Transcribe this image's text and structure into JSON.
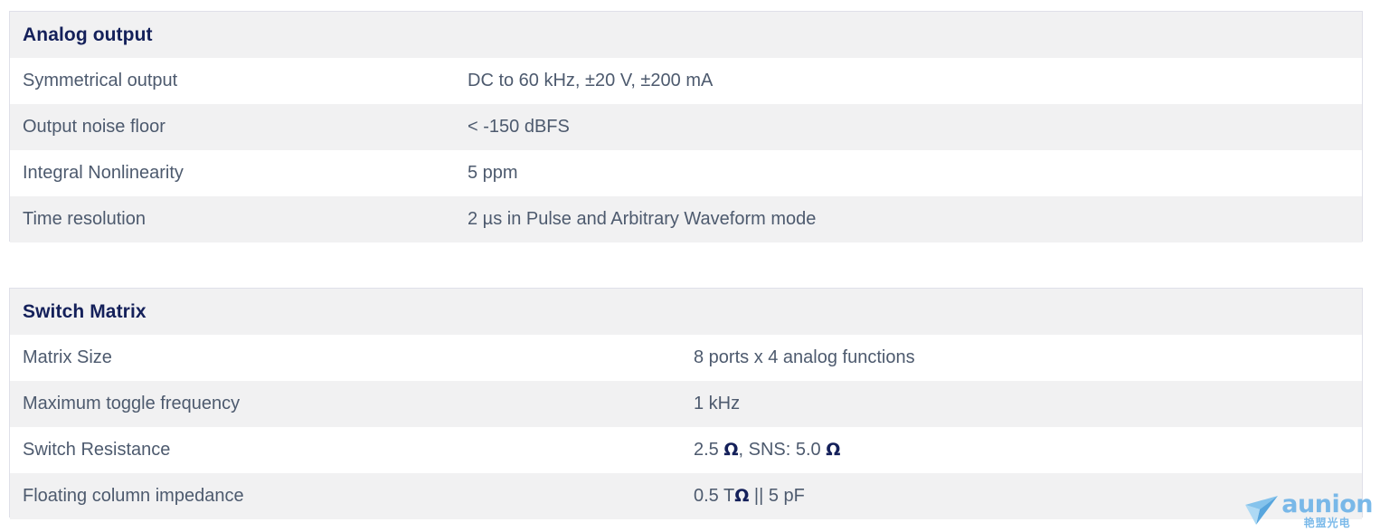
{
  "tables": [
    {
      "id": "analog-output",
      "title": "Analog output",
      "rows": [
        {
          "label": "Symmetrical output",
          "value": "DC to 60 kHz, ±20 V, ±200 mA"
        },
        {
          "label": "Output noise floor",
          "value": "< -150 dBFS"
        },
        {
          "label": "Integral Nonlinearity",
          "value": "5 ppm"
        },
        {
          "label": "Time resolution",
          "value": "2 µs in Pulse and Arbitrary Waveform mode"
        }
      ]
    },
    {
      "id": "switch-matrix",
      "title": "Switch Matrix",
      "rows": [
        {
          "label": "Matrix Size",
          "value": "8 ports x 4 analog functions"
        },
        {
          "label": "Maximum toggle frequency",
          "value": "1 kHz"
        },
        {
          "label": "Switch Resistance",
          "value": "2.5 Ω, SNS: 5.0 Ω"
        },
        {
          "label": "Floating column impedance",
          "value": "0.5 TΩ || 5 pF"
        }
      ]
    }
  ],
  "watermark": {
    "name": "aunion",
    "subtitle": "艳盟光电",
    "icon": "paper-plane-icon",
    "color": "#6fb4e8"
  },
  "colors": {
    "header_text": "#14205a",
    "body_text": "#4d5a6e",
    "stripe_bg": "#f1f1f2",
    "row_bg": "#ffffff",
    "border": "#dfe0e9"
  }
}
